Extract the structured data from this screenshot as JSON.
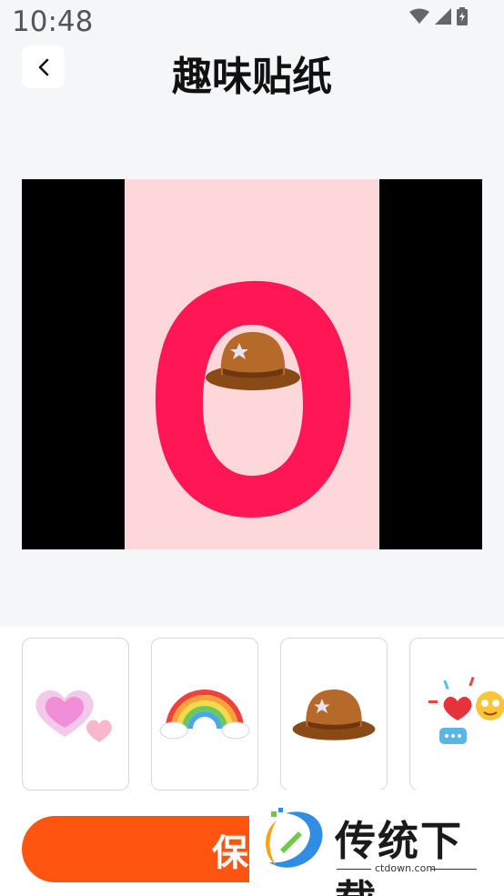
{
  "status_bar": {
    "time": "10:48",
    "icons": [
      "wifi-icon",
      "signal-icon",
      "battery-icon"
    ]
  },
  "header": {
    "title": "趣味贴纸",
    "back_icon": "chevron-left-icon"
  },
  "stickers": [
    {
      "name": "hearts"
    },
    {
      "name": "rainbow"
    },
    {
      "name": "cowboy-hat"
    },
    {
      "name": "heart-emoji-chat"
    }
  ],
  "actions": {
    "save_label": "保存"
  },
  "watermark": {
    "text": "传统下载",
    "url": "ctdown.com"
  },
  "colors": {
    "accent": "#ff5511",
    "ring": "#ff1654",
    "photo_bg": "#fdd7d9",
    "canvas_bg": "#000000"
  }
}
